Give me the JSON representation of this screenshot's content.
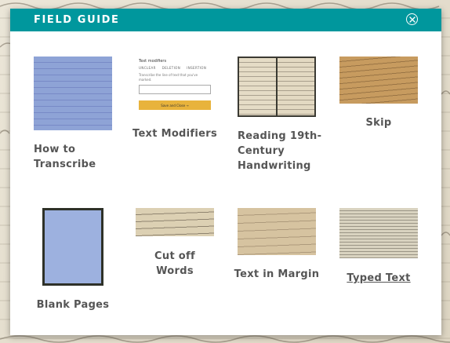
{
  "modal": {
    "title": "FIELD GUIDE",
    "close_icon": "close-circle-icon"
  },
  "items": [
    {
      "label_line1": "How to",
      "label_line2": "Transcribe",
      "thumb": "blue-manuscript"
    },
    {
      "label": "Text Modifiers",
      "thumb": "text-modifiers-panel"
    },
    {
      "label_line1": "Reading 19th-",
      "label_line2": "Century",
      "label_line3": "Handwriting",
      "thumb": "open-book"
    },
    {
      "label": "Skip",
      "thumb": "sepia-letter"
    },
    {
      "label": "Blank Pages",
      "thumb": "blank-blue-page"
    },
    {
      "label": "Cut off Words",
      "thumb": "handwriting-strip"
    },
    {
      "label": "Text in Margin",
      "thumb": "margin-note"
    },
    {
      "label": "Typed Text",
      "thumb": "typed-document"
    }
  ],
  "text_modifiers_thumb": {
    "title": "Text modifiers",
    "tabs": [
      "UNCLEAR",
      "DELETION",
      "INSERTION"
    ],
    "description": "Transcribe the line of text that you've marked.",
    "button": "Save and Close →"
  },
  "colors": {
    "header": "#00979d",
    "label": "#555555",
    "button": "#e8b33c"
  }
}
